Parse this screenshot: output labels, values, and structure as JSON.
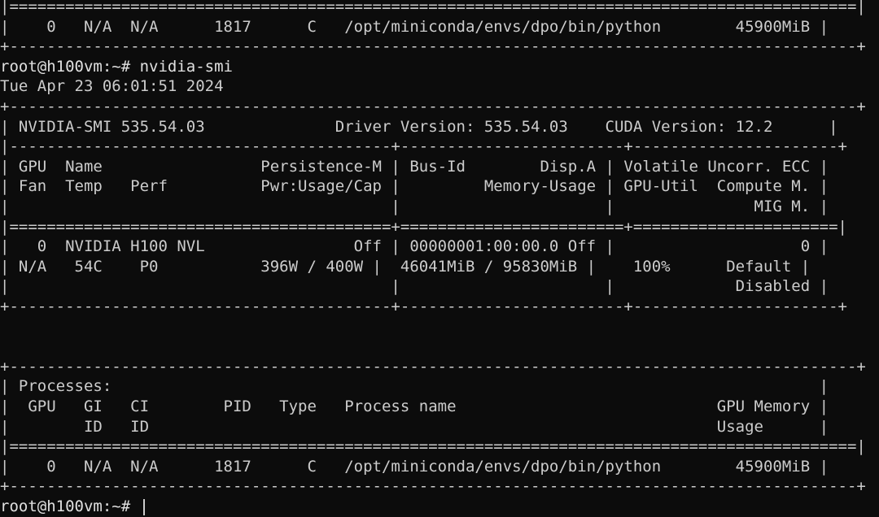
{
  "terminal": {
    "lines": [
      "|===========================================================================================|",
      "|    0   N/A  N/A      1817      C   /opt/miniconda/envs/dpo/bin/python        45900MiB |",
      "+-------------------------------------------------------------------------------------------+",
      "root@h100vm:~# nvidia-smi",
      "Tue Apr 23 06:01:51 2024",
      "+-------------------------------------------------------------------------------------------+",
      "| NVIDIA-SMI 535.54.03              Driver Version: 535.54.03    CUDA Version: 12.2      |",
      "|-----------------------------------------+------------------------+----------------------+",
      "| GPU  Name                 Persistence-M | Bus-Id        Disp.A | Volatile Uncorr. ECC |",
      "| Fan  Temp   Perf          Pwr:Usage/Cap |         Memory-Usage | GPU-Util  Compute M. |",
      "|                                         |                      |               MIG M. |",
      "|=========================================+========================+======================|",
      "|   0  NVIDIA H100 NVL                Off | 00000001:00:00.0 Off |                    0 |",
      "| N/A   54C    P0           396W / 400W |  46041MiB / 95830MiB |    100%      Default |",
      "|                                         |                      |             Disabled |",
      "+-----------------------------------------+------------------------+----------------------+",
      "",
      "",
      "+-------------------------------------------------------------------------------------------+",
      "| Processes:                                                                            |",
      "|  GPU   GI   CI        PID   Type   Process name                            GPU Memory |",
      "|        ID   ID                                                             Usage      |",
      "|===========================================================================================|",
      "|    0   N/A  N/A      1817      C   /opt/miniconda/envs/dpo/bin/python        45900MiB |",
      "+-------------------------------------------------------------------------------------------+",
      "root@h100vm:~# "
    ]
  }
}
